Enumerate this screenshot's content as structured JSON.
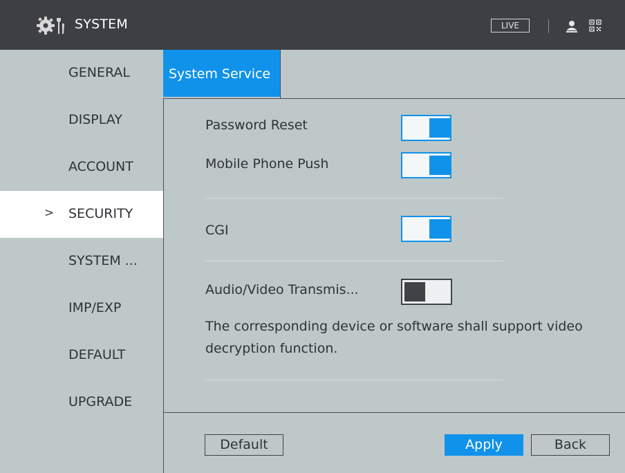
{
  "header": {
    "title": "SYSTEM",
    "live_label": "LIVE",
    "icons": [
      "settings-gear-icon",
      "user-icon",
      "qr-code-icon"
    ]
  },
  "sidebar": {
    "items": [
      {
        "label": "GENERAL",
        "active": false
      },
      {
        "label": "DISPLAY",
        "active": false
      },
      {
        "label": "ACCOUNT",
        "active": false
      },
      {
        "label": "SECURITY",
        "active": true
      },
      {
        "label": "SYSTEM ...",
        "active": false
      },
      {
        "label": "IMP/EXP",
        "active": false
      },
      {
        "label": "DEFAULT",
        "active": false
      },
      {
        "label": "UPGRADE",
        "active": false
      }
    ],
    "active_marker": ">"
  },
  "tabs": [
    {
      "label": "System Service",
      "active": true
    }
  ],
  "settings": {
    "password_reset": {
      "label": "Password Reset",
      "enabled": true
    },
    "mobile_push": {
      "label": "Mobile Phone Push",
      "enabled": true
    },
    "cgi": {
      "label": "CGI",
      "enabled": true
    },
    "av_transmission": {
      "label": "Audio/Video Transmis...",
      "enabled": false
    },
    "note": "The corresponding device or software shall support video decryption function."
  },
  "buttons": {
    "default": "Default",
    "apply": "Apply",
    "back": "Back"
  },
  "colors": {
    "accent": "#1192ea",
    "header_bg": "#3d3f44",
    "panel_bg": "#bfc8c9",
    "toggle_off": "#3f4246"
  }
}
